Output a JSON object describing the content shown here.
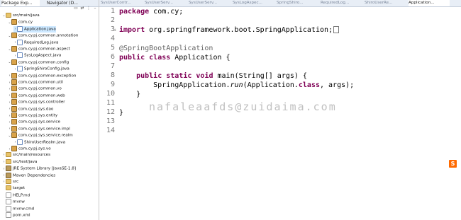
{
  "left_panel": {
    "tabs": [
      {
        "label": "Package Exp..."
      },
      {
        "label": "Navigator (D..."
      }
    ],
    "tree": [
      {
        "label": "src/main/java",
        "indent": 0,
        "twisty": "open",
        "icon": "source-folder-icon",
        "kind": "folder"
      },
      {
        "label": "com.cy",
        "indent": 1,
        "twisty": "open",
        "icon": "package-icon",
        "kind": "pkg"
      },
      {
        "label": "Application.java",
        "indent": 2,
        "twisty": "closed",
        "icon": "java-file-icon",
        "kind": "java",
        "selected": true
      },
      {
        "label": "com.cy.pj.common.annotation",
        "indent": 1,
        "twisty": "open",
        "icon": "package-icon",
        "kind": "pkg"
      },
      {
        "label": "RequiredLog.java",
        "indent": 2,
        "twisty": "closed",
        "icon": "java-file-icon",
        "kind": "java"
      },
      {
        "label": "com.cy.pj.common.aspect",
        "indent": 1,
        "twisty": "open",
        "icon": "package-icon",
        "kind": "pkg"
      },
      {
        "label": "SysLogAspect.java",
        "indent": 2,
        "twisty": "closed",
        "icon": "java-file-icon",
        "kind": "java"
      },
      {
        "label": "com.cy.pj.common.config",
        "indent": 1,
        "twisty": "open",
        "icon": "package-icon",
        "kind": "pkg"
      },
      {
        "label": "SpringShiroConfig.java",
        "indent": 2,
        "twisty": "closed",
        "icon": "java-file-icon",
        "kind": "java"
      },
      {
        "label": "com.cy.pj.common.exception",
        "indent": 1,
        "twisty": "closed",
        "icon": "package-icon",
        "kind": "pkg"
      },
      {
        "label": "com.cy.pj.common.util",
        "indent": 1,
        "twisty": "closed",
        "icon": "package-icon",
        "kind": "pkg"
      },
      {
        "label": "com.cy.pj.common.vo",
        "indent": 1,
        "twisty": "closed",
        "icon": "package-icon",
        "kind": "pkg"
      },
      {
        "label": "com.cy.pj.common.web",
        "indent": 1,
        "twisty": "closed",
        "icon": "package-icon",
        "kind": "pkg"
      },
      {
        "label": "com.cy.pj.sys.controller",
        "indent": 1,
        "twisty": "closed",
        "icon": "package-icon",
        "kind": "pkg"
      },
      {
        "label": "com.cy.pj.sys.dao",
        "indent": 1,
        "twisty": "closed",
        "icon": "package-icon",
        "kind": "pkg"
      },
      {
        "label": "com.cy.pj.sys.entity",
        "indent": 1,
        "twisty": "closed",
        "icon": "package-icon",
        "kind": "pkg"
      },
      {
        "label": "com.cy.pj.sys.service",
        "indent": 1,
        "twisty": "closed",
        "icon": "package-icon",
        "kind": "pkg"
      },
      {
        "label": "com.cy.pj.sys.service.impl",
        "indent": 1,
        "twisty": "closed",
        "icon": "package-icon",
        "kind": "pkg"
      },
      {
        "label": "com.cy.pj.sys.service.realm",
        "indent": 1,
        "twisty": "open",
        "icon": "package-icon",
        "kind": "pkg"
      },
      {
        "label": "ShiroUserRealm.java",
        "indent": 2,
        "twisty": "closed",
        "icon": "java-file-icon",
        "kind": "java"
      },
      {
        "label": "com.cy.pj.sys.vo",
        "indent": 1,
        "twisty": "closed",
        "icon": "package-icon",
        "kind": "pkg"
      },
      {
        "label": "src/main/resources",
        "indent": 0,
        "twisty": "closed",
        "icon": "source-folder-icon",
        "kind": "folder"
      },
      {
        "label": "src/test/java",
        "indent": 0,
        "twisty": "closed",
        "icon": "source-folder-icon",
        "kind": "folder"
      },
      {
        "label": "JRE System Library [JavaSE-1.8]",
        "indent": 0,
        "twisty": "closed",
        "icon": "library-icon",
        "kind": "jar"
      },
      {
        "label": "Maven Dependencies",
        "indent": 0,
        "twisty": "closed",
        "icon": "library-icon",
        "kind": "jar"
      },
      {
        "label": "src",
        "indent": 0,
        "twisty": "closed",
        "icon": "folder-icon",
        "kind": "folder"
      },
      {
        "label": "target",
        "indent": 0,
        "twisty": "none",
        "icon": "folder-icon",
        "kind": "folder"
      },
      {
        "label": "HELP.md",
        "indent": 0,
        "twisty": "none",
        "icon": "file-icon",
        "kind": "file"
      },
      {
        "label": "mvnw",
        "indent": 0,
        "twisty": "none",
        "icon": "file-icon",
        "kind": "file"
      },
      {
        "label": "mvnw.cmd",
        "indent": 0,
        "twisty": "none",
        "icon": "file-icon",
        "kind": "file"
      },
      {
        "label": "pom.xml",
        "indent": 0,
        "twisty": "none",
        "icon": "file-icon",
        "kind": "file"
      }
    ]
  },
  "editor": {
    "tabs": [
      {
        "label": "SysUserContr...",
        "active": false
      },
      {
        "label": "SysUserServ...",
        "active": false
      },
      {
        "label": "SysUserServ...",
        "active": false
      },
      {
        "label": "SysLogAspec...",
        "active": false
      },
      {
        "label": "SpringShiro...",
        "active": false
      },
      {
        "label": "RequiredLog...",
        "active": false
      },
      {
        "label": "ShiroUserRe...",
        "active": false
      },
      {
        "label": "Application...",
        "active": true
      }
    ],
    "line_numbers": [
      "1",
      "2",
      "3",
      "4",
      "5",
      "6",
      "7",
      "8",
      "9",
      "10",
      "11",
      "12",
      "13",
      "14"
    ],
    "lines": [
      [
        {
          "t": "package",
          "c": "kw"
        },
        {
          "t": " com.cy;",
          "c": ""
        }
      ],
      [],
      [
        {
          "t": "import",
          "c": "kw"
        },
        {
          "t": " org.springframework.boot.SpringApplication;",
          "c": ""
        }
      ],
      [],
      [
        {
          "t": "@SpringBootApplication",
          "c": "ann"
        }
      ],
      [
        {
          "t": "public",
          "c": "kw"
        },
        {
          "t": " ",
          "c": ""
        },
        {
          "t": "class",
          "c": "kw"
        },
        {
          "t": " Application {",
          "c": ""
        }
      ],
      [],
      [
        {
          "t": "    ",
          "c": ""
        },
        {
          "t": "public",
          "c": "kw"
        },
        {
          "t": " ",
          "c": ""
        },
        {
          "t": "static",
          "c": "kw"
        },
        {
          "t": " ",
          "c": ""
        },
        {
          "t": "void",
          "c": "kw"
        },
        {
          "t": " main(String[] args) {",
          "c": ""
        }
      ],
      [
        {
          "t": "        SpringApplication.",
          "c": ""
        },
        {
          "t": "run",
          "c": "it"
        },
        {
          "t": "(Application.",
          "c": ""
        },
        {
          "t": "class",
          "c": "kw"
        },
        {
          "t": ", args);",
          "c": ""
        }
      ],
      [
        {
          "t": "    }",
          "c": ""
        }
      ],
      [],
      [
        {
          "t": "}",
          "c": ""
        }
      ],
      [],
      []
    ],
    "watermark": "nafaleaafds@zuidaima.com"
  }
}
